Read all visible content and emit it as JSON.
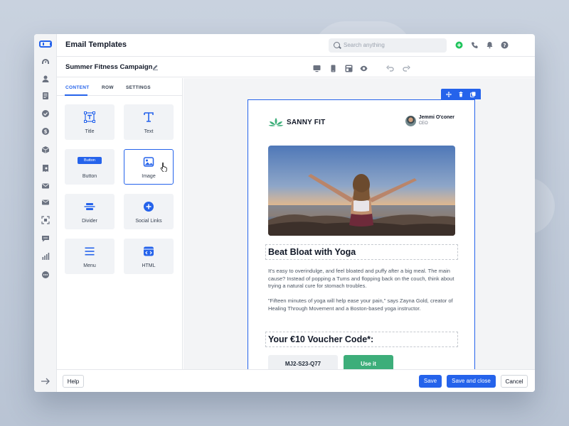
{
  "header": {
    "title": "Email Templates",
    "search_placeholder": "Search anything"
  },
  "subheader": {
    "campaign_name": "Summer Fitness Campaign"
  },
  "panel": {
    "tabs": [
      {
        "label": "CONTENT"
      },
      {
        "label": "ROW"
      },
      {
        "label": "SETTINGS"
      }
    ],
    "blocks": [
      {
        "label": "Title",
        "icon": "title-icon"
      },
      {
        "label": "Text",
        "icon": "text-icon"
      },
      {
        "label": "Button",
        "icon": "button-icon",
        "preview_label": "Button"
      },
      {
        "label": "Image",
        "icon": "image-icon"
      },
      {
        "label": "Divider",
        "icon": "divider-icon"
      },
      {
        "label": "Social Links",
        "icon": "social-links-icon"
      },
      {
        "label": "Menu",
        "icon": "menu-icon"
      },
      {
        "label": "HTML",
        "icon": "html-icon"
      }
    ]
  },
  "email": {
    "brand_name": "SANNY FIT",
    "author_name": "Jemmi O'coner",
    "author_role": "CEO",
    "heading": "Beat Bloat with Yoga",
    "paragraph1": "It's easy to overindulge, and feel bloated and puffy after a big meal. The main cause? Instead of popping a Tums and flopping back on the couch, think about trying a natural cure for stomach troubles.",
    "paragraph2": "\"Fifteen minutes of yoga will help ease your pain,\" says Zayna Gold, creator of Healing Through Movement and a Boston-based yoga instructor.",
    "voucher_heading": "Your €10 Voucher Code*:",
    "voucher_code": "MJ2-S23-Q77",
    "cta_label": "Use it"
  },
  "footer": {
    "help_label": "Help",
    "save_label": "Save",
    "save_close_label": "Save and close",
    "cancel_label": "Cancel"
  },
  "colors": {
    "accent": "#2563eb",
    "cta_green": "#3dae7a",
    "online_green": "#22c55e"
  }
}
